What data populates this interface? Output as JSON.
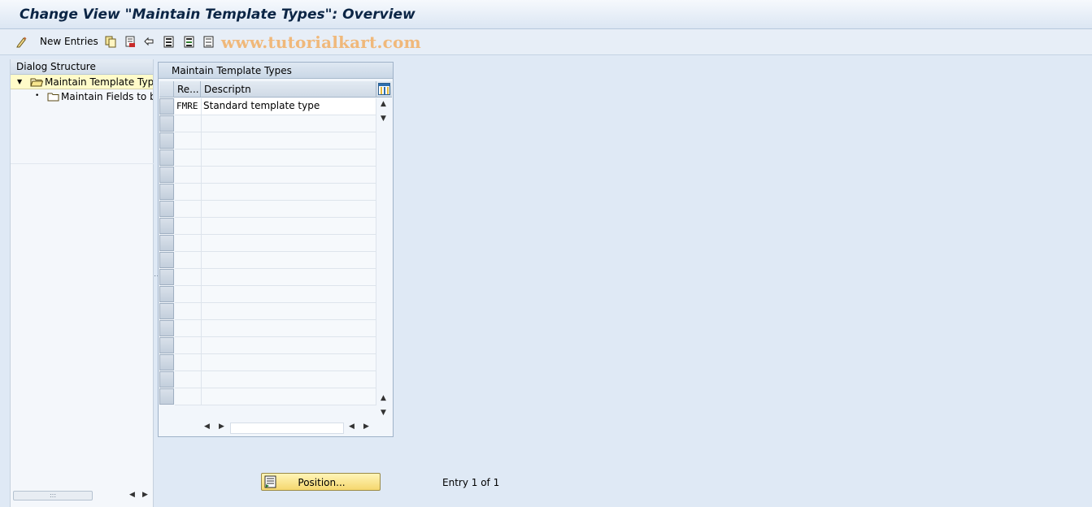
{
  "title": "Change View \"Maintain Template Types\": Overview",
  "toolbar": {
    "new_entries_label": "New Entries",
    "icons": [
      "edit-icon",
      "copy-icon",
      "delete-icon",
      "undo-icon",
      "select-all-icon",
      "select-block-icon",
      "deselect-all-icon"
    ]
  },
  "watermark": "www.tutorialkart.com",
  "dialog_structure": {
    "header": "Dialog Structure",
    "items": [
      {
        "label": "Maintain Template Type",
        "selected": true,
        "level": 0
      },
      {
        "label": "Maintain Fields to be",
        "selected": false,
        "level": 1
      }
    ]
  },
  "table": {
    "title": "Maintain Template Types",
    "columns": [
      "Re...",
      "Descriptn"
    ],
    "rows": [
      [
        "FMRE",
        "Standard template type"
      ],
      [
        "",
        ""
      ],
      [
        "",
        ""
      ],
      [
        "",
        ""
      ],
      [
        "",
        ""
      ],
      [
        "",
        ""
      ],
      [
        "",
        ""
      ],
      [
        "",
        ""
      ],
      [
        "",
        ""
      ],
      [
        "",
        ""
      ],
      [
        "",
        ""
      ],
      [
        "",
        ""
      ],
      [
        "",
        ""
      ],
      [
        "",
        ""
      ],
      [
        "",
        ""
      ],
      [
        "",
        ""
      ],
      [
        "",
        ""
      ],
      [
        "",
        ""
      ]
    ]
  },
  "position_button": "Position...",
  "entry_info": "Entry 1 of 1",
  "colors": {
    "background": "#dfe9f5",
    "selected_node": "#fffbc9",
    "button": "#f5d76e"
  }
}
